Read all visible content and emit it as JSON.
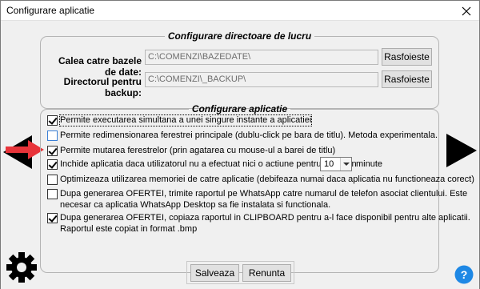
{
  "window": {
    "title": "Configurare aplicatie"
  },
  "dir_group": {
    "legend": "Configurare directoare de lucru",
    "db_label": "Calea catre bazele de date:",
    "db_value": "C:\\COMENZI\\BAZEDATE\\",
    "backup_label": "Directorul pentru backup:",
    "backup_value": "C:\\COMENZI\\_BACKUP\\",
    "browse_label": "Rasfoieste"
  },
  "app_group": {
    "legend": "Configurare aplicatie",
    "options": [
      {
        "text": "Permite executarea simultana a unei singure instante a aplicatiei",
        "checked": true
      },
      {
        "text": "Permite redimensionarea ferestrei principale (dublu-click pe bara de titlu). Metoda experimentala.",
        "checked": false
      },
      {
        "text": "Permite mutarea ferestrelor (prin agatarea cu mouse-ul a barei de titlu)",
        "checked": true
      },
      {
        "text": "Inchide aplicatia daca utilizatorul nu a efectuat nici o actiune pentru cel putin",
        "checked": true
      },
      {
        "text": "Optimizeaza utilizarea memoriei de catre aplicatie (debifeaza numai daca aplicatia nu functioneaza corect)",
        "checked": false
      },
      {
        "text": "Dupa generarea OFERTEI, trimite raportul pe WhatsApp catre numarul de telefon asociat clientului.  Este",
        "text2": "necesar ca aplicatia WhatsApp Desktop sa fie instalata si functionala.",
        "checked": false
      },
      {
        "text": "Dupa generarea OFERTEI, copiaza raportul in CLIPBOARD pentru a-l face disponibil pentru alte aplicatii.",
        "text2": "Raportul este copiat in format .bmp",
        "checked": true
      }
    ],
    "idle_minutes": "10",
    "minutes_label": "minute"
  },
  "buttons": {
    "save": "Salveaza",
    "cancel": "Renunta"
  },
  "colors": {
    "arrow_red": "#e8343a",
    "help_blue": "#1e88e5",
    "checkbox_blue": "#3a7fd6"
  }
}
